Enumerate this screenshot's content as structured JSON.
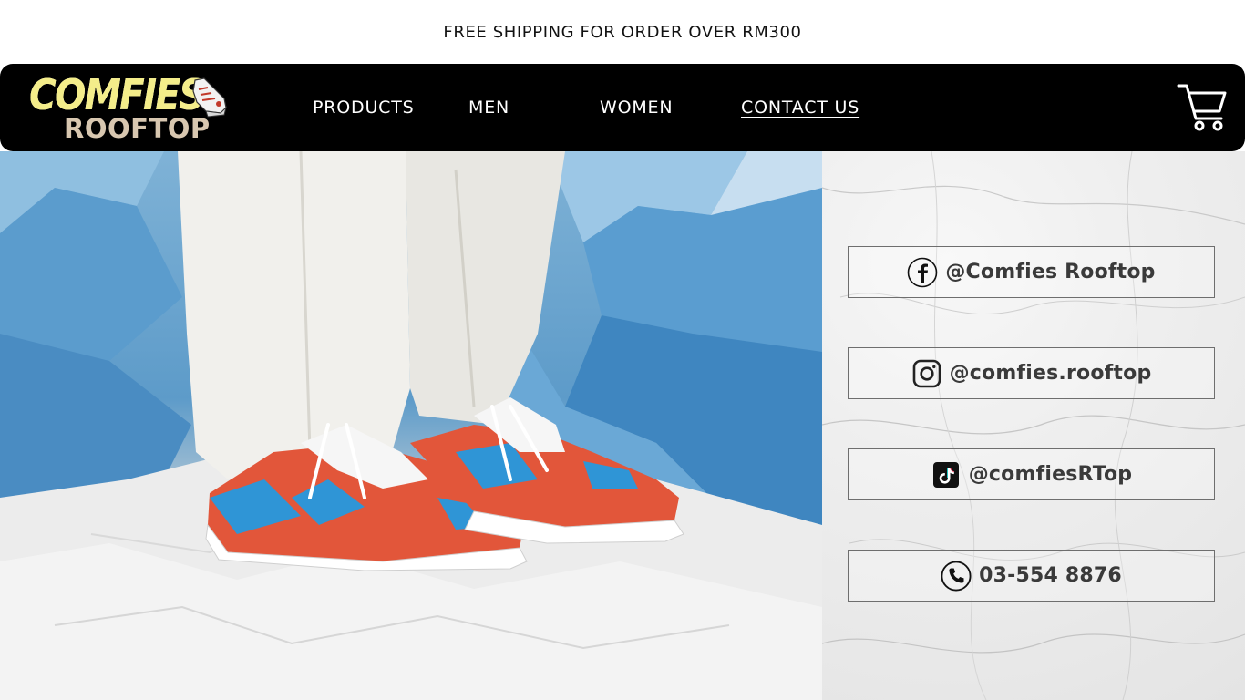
{
  "announcement": "FREE SHIPPING FOR ORDER OVER RM300",
  "brand": {
    "line1": "COMFIES",
    "line2": "ROOFTOP"
  },
  "nav": {
    "products": "PRODUCTS",
    "men": "MEN",
    "women": "WOMEN",
    "contact": "CONTACT US"
  },
  "contacts": {
    "facebook": "@Comfies Rooftop",
    "instagram": "@comfies.rooftop",
    "tiktok": "@comfiesRTop",
    "phone": "03-554 8876"
  },
  "colors": {
    "nav_bg": "#000000",
    "logo_yellow": "#f4ed8a",
    "logo_beige": "#d8c7b0",
    "shoe_red": "#e2563a",
    "shoe_blue": "#2f95d6"
  },
  "icons": [
    "facebook-icon",
    "instagram-icon",
    "tiktok-icon",
    "phone-icon",
    "cart-icon"
  ]
}
